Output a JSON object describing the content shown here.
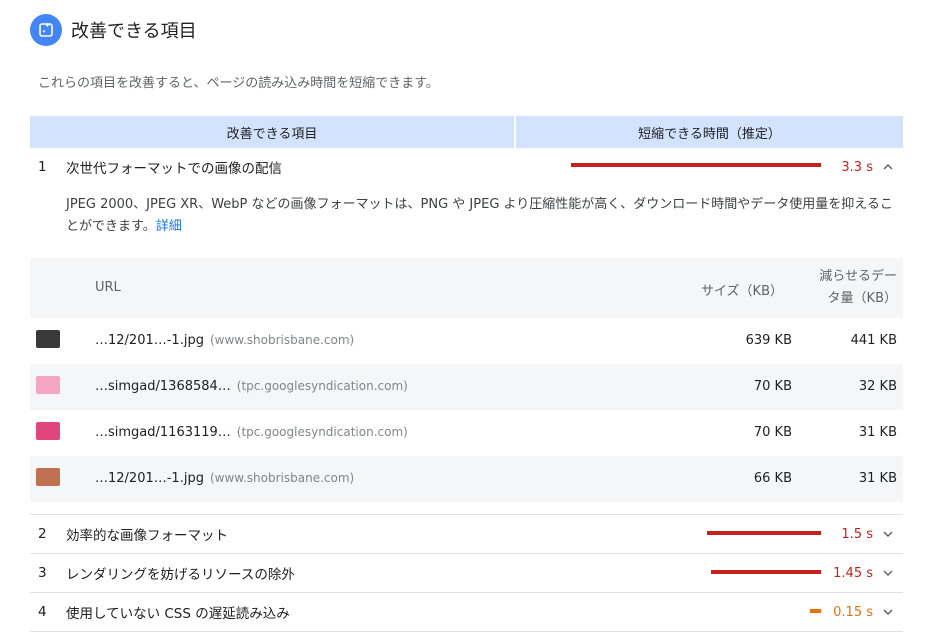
{
  "header": {
    "title": "改善できる項目",
    "icon": "insight-icon",
    "accent": "#4285f4"
  },
  "description": "これらの項目を改善すると、ページの読み込み時間を短縮できます。",
  "table": {
    "col_item": "改善できる項目",
    "col_savings": "短縮できる時間（推定）"
  },
  "audits": [
    {
      "num": "1",
      "title": "次世代フォーマットでの画像の配信",
      "value": "3.3 s",
      "fraction": 1.0,
      "level": "red",
      "expanded": true
    },
    {
      "num": "2",
      "title": "効率的な画像フォーマット",
      "value": "1.5 s",
      "fraction": 0.455,
      "level": "red",
      "expanded": false
    },
    {
      "num": "3",
      "title": "レンダリングを妨げるリソースの除外",
      "value": "1.45 s",
      "fraction": 0.44,
      "level": "red",
      "expanded": false
    },
    {
      "num": "4",
      "title": "使用していない CSS の遅延読み込み",
      "value": "0.15 s",
      "fraction": 0.045,
      "level": "orange",
      "expanded": false
    }
  ],
  "detail": {
    "text": "JPEG 2000、JPEG XR、WebP などの画像フォーマットは、PNG や JPEG より圧縮性能が高く、ダウンロード時間やデータ使用量を抑えることができます。",
    "link": "詳細"
  },
  "resources": {
    "col_url": "URL",
    "col_size": "サイズ（KB）",
    "col_savings": "減らせるデータ量（KB）",
    "rows": [
      {
        "url": "…12/201…-1.jpg",
        "host": "(www.shobrisbane.com)",
        "size": "639 KB",
        "savings": "441 KB",
        "thumb": "#3a3a3a"
      },
      {
        "url": "…simgad/1368584…",
        "host": "(tpc.googlesyndication.com)",
        "size": "70 KB",
        "savings": "32 KB",
        "thumb": "#f4a6c0"
      },
      {
        "url": "…simgad/1163119…",
        "host": "(tpc.googlesyndication.com)",
        "size": "70 KB",
        "savings": "31 KB",
        "thumb": "#e0457b"
      },
      {
        "url": "…12/201…-1.jpg",
        "host": "(www.shobrisbane.com)",
        "size": "66 KB",
        "savings": "31 KB",
        "thumb": "#c0714f"
      }
    ]
  },
  "colors": {
    "red": "#c5221f",
    "orange": "#e8710a",
    "link": "#1a73e8"
  }
}
